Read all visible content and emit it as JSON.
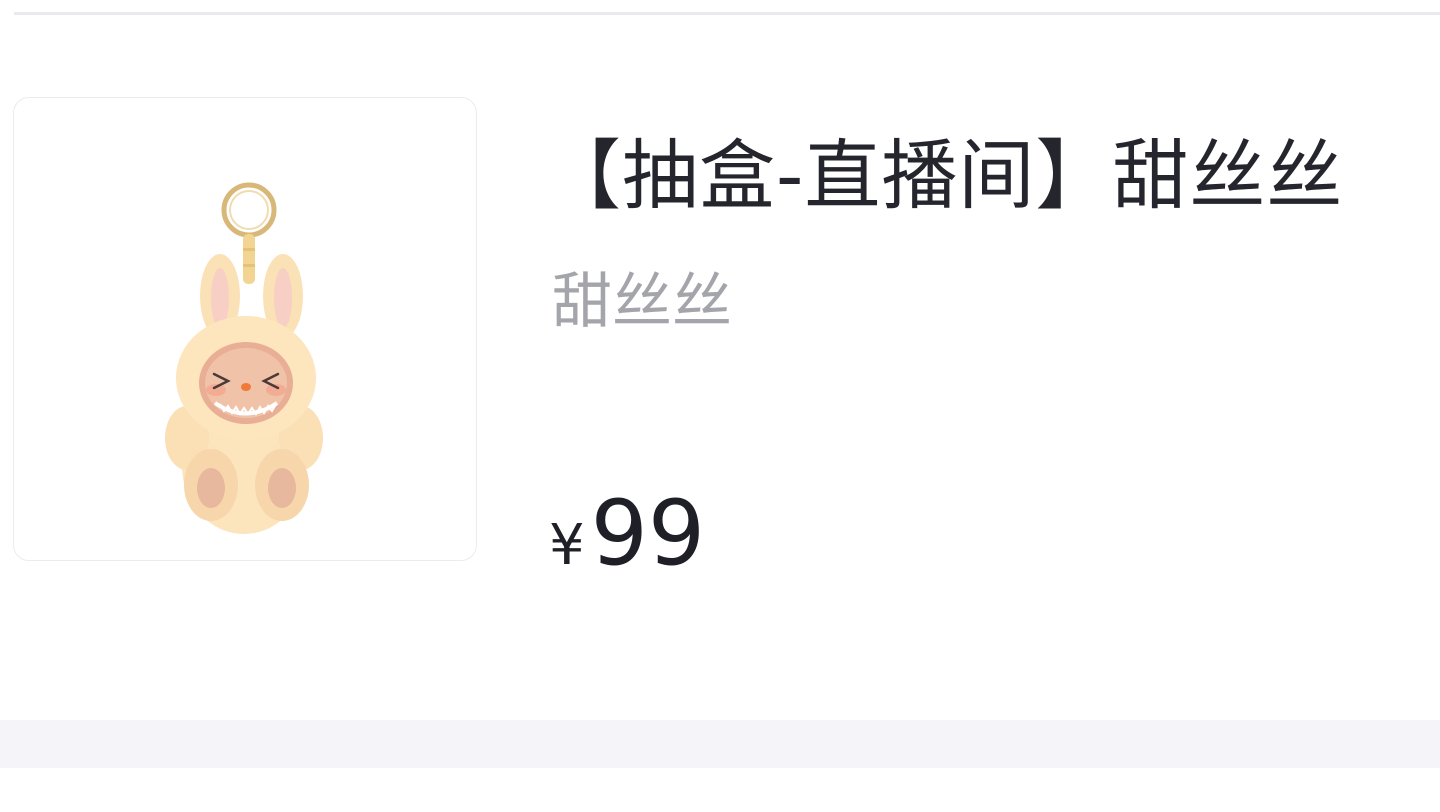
{
  "product": {
    "title": "【抽盒-直播间】甜丝丝",
    "subtitle": "甜丝丝",
    "price_symbol": "¥",
    "price_value": "99",
    "image": {
      "icon": "bunny-plush-keychain"
    }
  },
  "colors": {
    "title": "#25252e",
    "subtitle": "#a4a4ab",
    "price": "#1f1f28",
    "card_border": "#ececf0",
    "divider": "#e9e9ee",
    "bottom_band": "#f4f4f9",
    "plush": "#fbe3b6"
  }
}
